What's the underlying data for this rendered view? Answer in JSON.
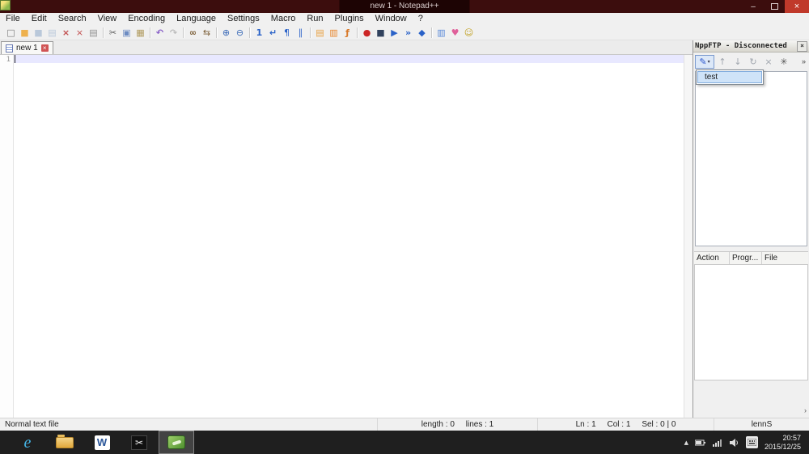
{
  "titlebar": {
    "title": "new 1 - Notepad++",
    "minimize_glyph": "–",
    "close_glyph": "×"
  },
  "menu": {
    "items": [
      "File",
      "Edit",
      "Search",
      "View",
      "Encoding",
      "Language",
      "Settings",
      "Macro",
      "Run",
      "Plugins",
      "Window",
      "?"
    ]
  },
  "toolbar": {
    "icons": [
      {
        "name": "new-file",
        "glyph": "□",
        "css": "color:#7a7a7a"
      },
      {
        "name": "open-folder",
        "glyph": "■",
        "css": "color:#eeb14d"
      },
      {
        "name": "save",
        "glyph": "■",
        "css": "color:#b9c8da"
      },
      {
        "name": "save-all",
        "glyph": "▤",
        "css": "color:#b9c8da"
      },
      {
        "name": "close-file",
        "glyph": "×",
        "css": "color:#c25050;font-weight:bold"
      },
      {
        "name": "close-all-files",
        "glyph": "×",
        "css": "color:#c25050"
      },
      {
        "name": "print",
        "glyph": "▤",
        "css": "color:#8f8f8f"
      },
      {
        "name": "cut",
        "glyph": "✂",
        "css": "color:#5a5a5a"
      },
      {
        "name": "copy",
        "glyph": "▣",
        "css": "color:#6d8cc2"
      },
      {
        "name": "paste",
        "glyph": "▦",
        "css": "color:#b09a5e"
      },
      {
        "name": "undo",
        "glyph": "↶",
        "css": "color:#8a62c8;font-weight:bold"
      },
      {
        "name": "redo",
        "glyph": "↷",
        "css": "color:#bdbdbd;font-weight:bold"
      },
      {
        "name": "find",
        "glyph": "∞",
        "css": "color:#7a5c34;font-weight:bold"
      },
      {
        "name": "replace",
        "glyph": "⇆",
        "css": "color:#7a5c34"
      },
      {
        "name": "zoom-in",
        "glyph": "⊕",
        "css": "color:#3a6ab8"
      },
      {
        "name": "zoom-out",
        "glyph": "⊖",
        "css": "color:#3a6ab8"
      },
      {
        "name": "restore-default-zoom",
        "glyph": "1",
        "css": "color:#2a62c8;font-weight:bold"
      },
      {
        "name": "word-wrap",
        "glyph": "↵",
        "css": "color:#2a62c8;font-weight:bold"
      },
      {
        "name": "show-all-characters",
        "glyph": "¶",
        "css": "color:#2a62c8"
      },
      {
        "name": "show-indent-guide",
        "glyph": "∥",
        "css": "color:#2a62c8"
      },
      {
        "name": "user-defined-language",
        "glyph": "▤",
        "css": "color:#e8a040"
      },
      {
        "name": "document-map",
        "glyph": "▥",
        "css": "color:#e8842a"
      },
      {
        "name": "function-list",
        "glyph": "ƒ",
        "css": "color:#d87828;font-weight:bold"
      },
      {
        "name": "record-macro",
        "glyph": "●",
        "css": "color:#cc2626"
      },
      {
        "name": "stop-recording",
        "glyph": "■",
        "css": "color:#31425e"
      },
      {
        "name": "playback-macro",
        "glyph": "▶",
        "css": "color:#2a62c8"
      },
      {
        "name": "run-macro-multiple-times",
        "glyph": "»",
        "css": "color:#2a62c8;font-weight:bold"
      },
      {
        "name": "save-recorded-macro",
        "glyph": "◆",
        "css": "color:#2a62c8"
      },
      {
        "name": "find-result-window",
        "glyph": "▥",
        "css": "color:#5a8ad8"
      },
      {
        "name": "compare-plugin",
        "glyph": "♥",
        "css": "color:#e0609a"
      },
      {
        "name": "nppexport-plugin",
        "glyph": "☺",
        "css": "color:#c0a020"
      }
    ]
  },
  "tab": {
    "label": "new 1",
    "close_glyph": "×"
  },
  "editor": {
    "line_number": "1"
  },
  "ftp": {
    "title": "NppFTP - Disconnected",
    "close_glyph": "×",
    "toolbar": [
      {
        "name": "connect",
        "glyph": "✎",
        "css": "color:#2a55cc"
      },
      {
        "name": "upload-file",
        "glyph": "↑",
        "css": "color:#a0a6ae"
      },
      {
        "name": "download-file",
        "glyph": "↓",
        "css": "color:#a0a6ae"
      },
      {
        "name": "refresh",
        "glyph": "↻",
        "css": "color:#a0a6ae"
      },
      {
        "name": "abort",
        "glyph": "×",
        "css": "color:#a0a6ae"
      },
      {
        "name": "settings",
        "glyph": "✳",
        "css": "color:#555555"
      }
    ],
    "dropdown_arrow": "▾",
    "overflow": "»",
    "profiles": [
      "test"
    ],
    "queue_columns": [
      "Action",
      "Progr...",
      "File"
    ],
    "scroll_arrow": "›"
  },
  "status": {
    "doc_type": "Normal text file",
    "length_lines": "length : 0     lines : 1",
    "position": "Ln : 1     Col : 1     Sel : 0 | 0",
    "right": "lennS"
  },
  "taskbar": {
    "ie_glyph": "e",
    "word_glyph": "W",
    "scissors_glyph": "✂",
    "tray": {
      "chevron": "▲",
      "time": "20:57",
      "date": "2015/12/25"
    }
  }
}
